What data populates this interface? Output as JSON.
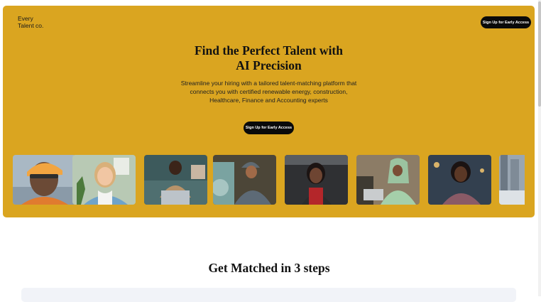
{
  "brand": {
    "line1": "Every",
    "line2": "Talent co.",
    "color": "#daa520"
  },
  "header": {
    "cta_label": "Sign Up for Early Access"
  },
  "hero": {
    "headline_line1": "Find the Perfect Talent with",
    "headline_line2": "AI Precision",
    "subtext": "Streamline your hiring with a tailored talent-matching platform that connects you with certified renewable energy, construction, Healthcare, Finance and Accounting experts",
    "cta_label": "Sign Up for Early Access"
  },
  "gallery": {
    "items": [
      {
        "name": "construction-worker-photo",
        "bg": "#a9b8c4"
      },
      {
        "name": "smiling-professional-photo",
        "bg": "#b8c9b4"
      },
      {
        "name": "laptop-worker-photo",
        "bg": "#3d5a5c"
      },
      {
        "name": "mechanic-photo",
        "bg": "#4c4638"
      },
      {
        "name": "support-agent-photo",
        "bg": "#2f3033"
      },
      {
        "name": "office-worker-photo",
        "bg": "#8c7c66"
      },
      {
        "name": "city-professional-photo",
        "bg": "#33404f"
      },
      {
        "name": "city-scene-photo",
        "bg": "#9aa6b2"
      }
    ]
  },
  "steps": {
    "title": "Get Matched in 3 steps"
  }
}
